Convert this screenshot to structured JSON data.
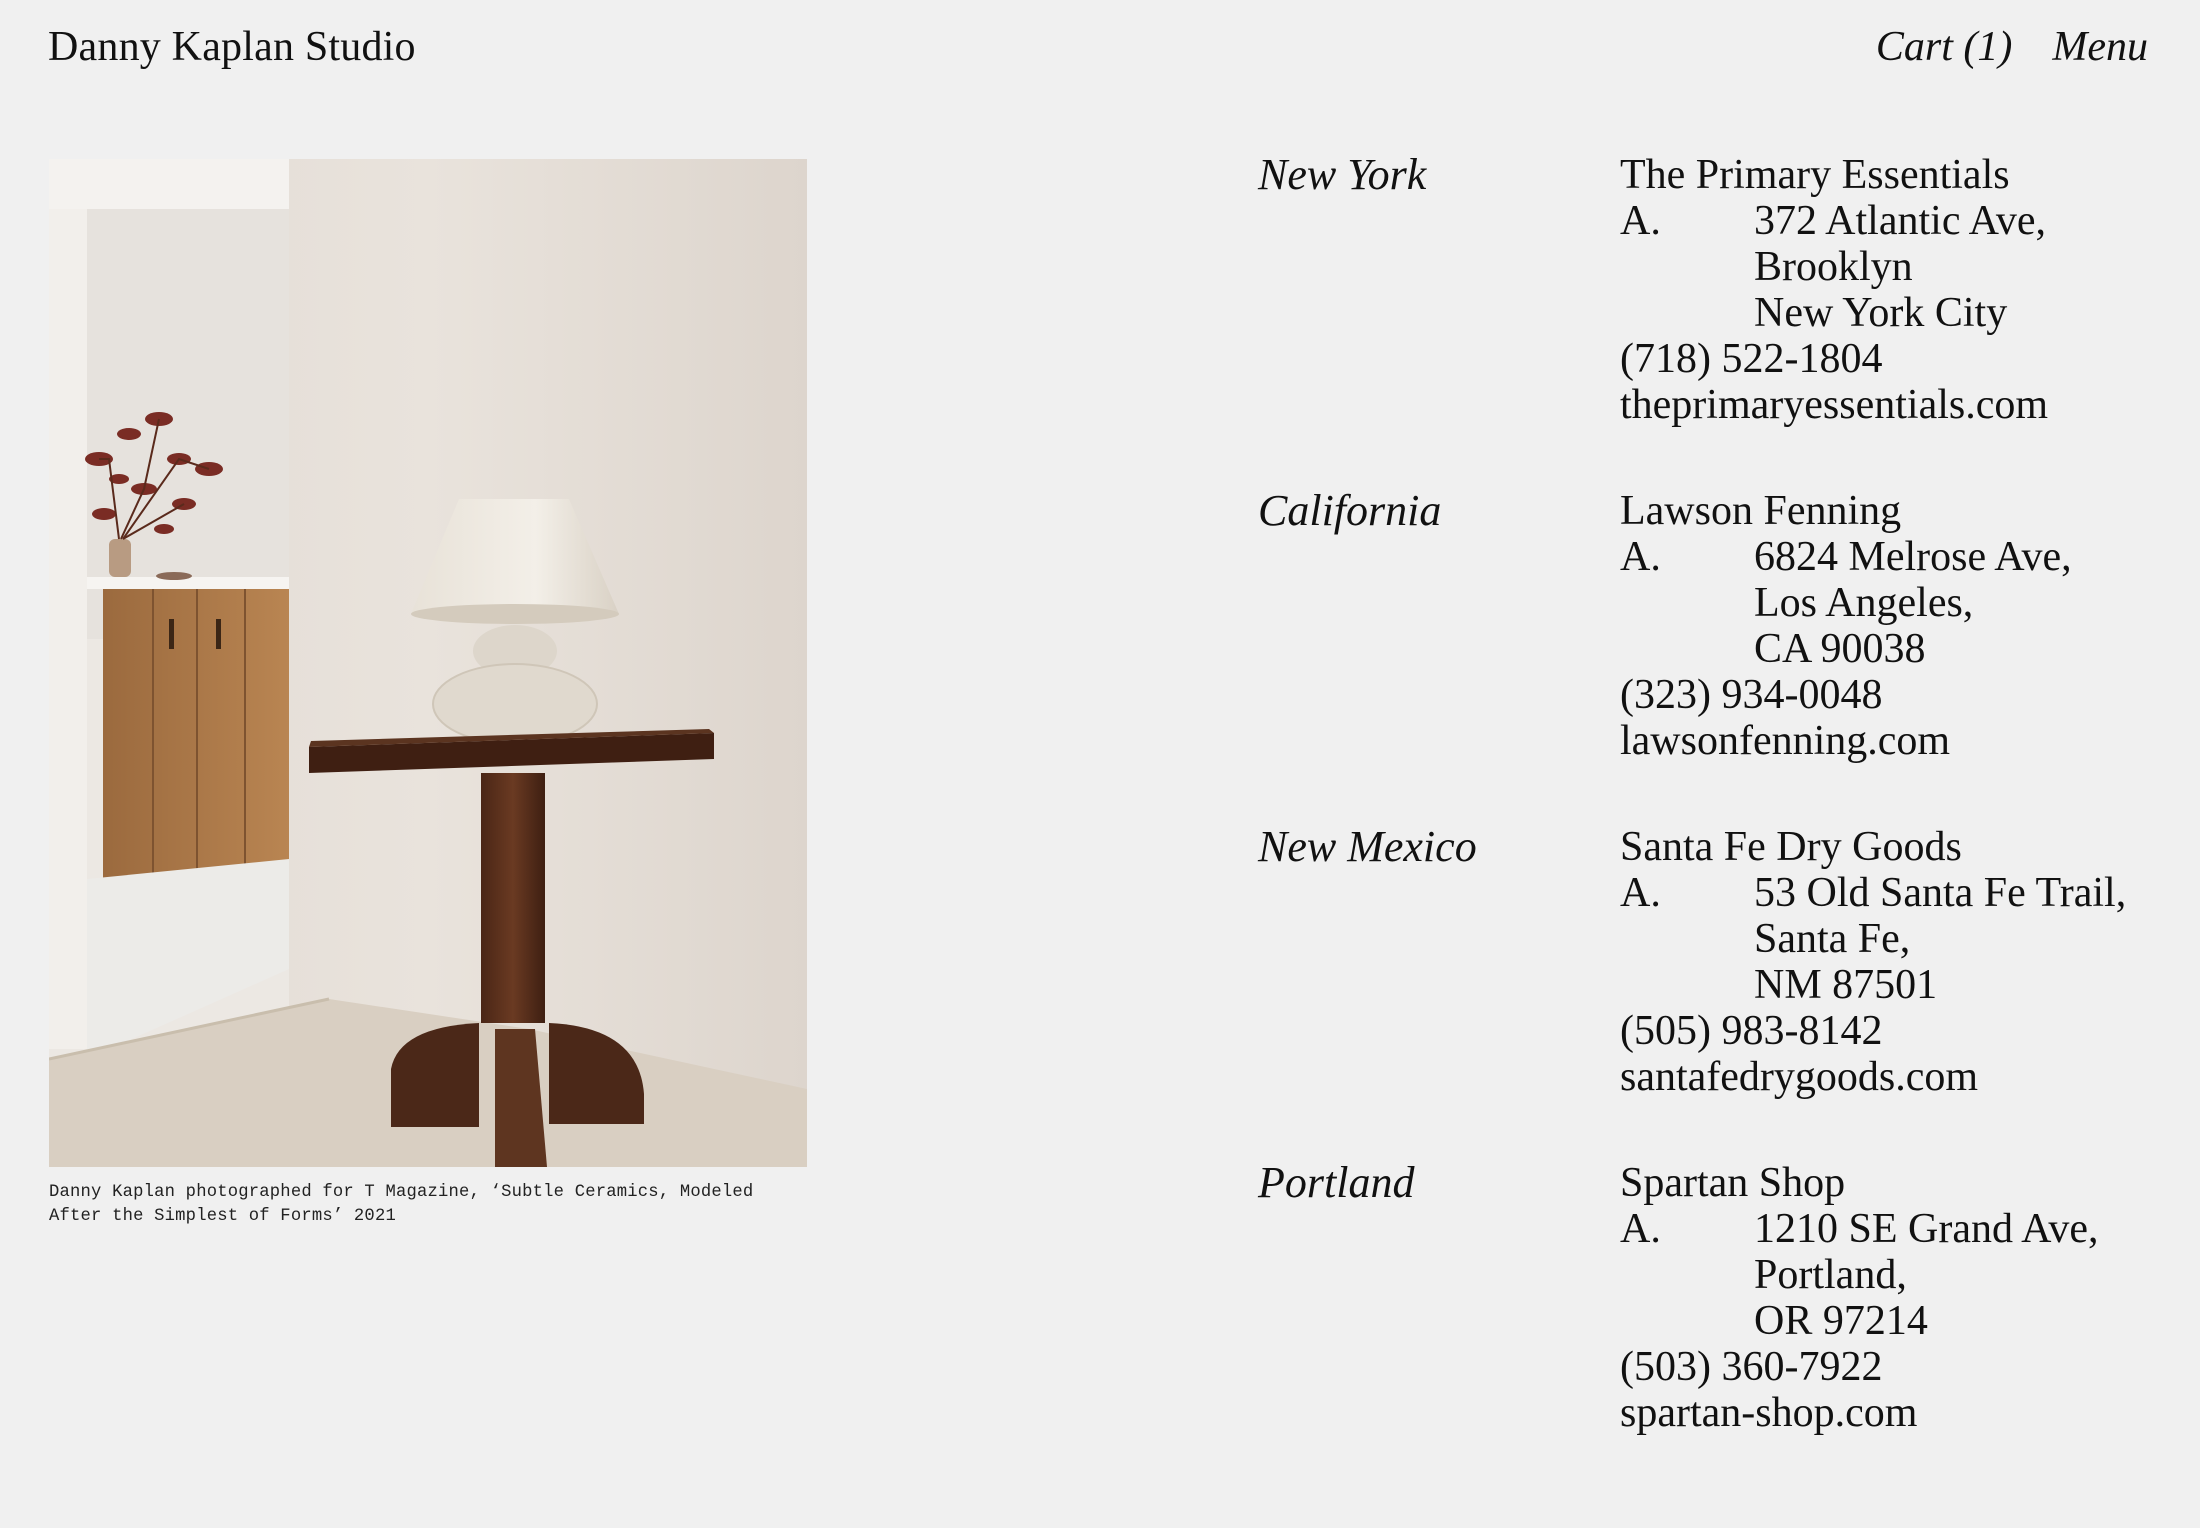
{
  "header": {
    "brand": "Danny Kaplan Studio",
    "cart_label": "Cart (1)",
    "menu_label": "Menu"
  },
  "figure": {
    "caption_line1": "Danny Kaplan photographed for T Magazine, ‘Subtle Ceramics, Modeled",
    "caption_line2": "After the Simplest of Forms’ 2021"
  },
  "stockists": [
    {
      "region": "New York",
      "name": "The Primary Essentials",
      "address_label": "A.",
      "address": [
        "372 Atlantic Ave,",
        "Brooklyn",
        "New York City"
      ],
      "phone": "(718) 522-1804",
      "website": "theprimaryessentials.com"
    },
    {
      "region": "California",
      "name": "Lawson Fenning",
      "address_label": "A.",
      "address": [
        "6824 Melrose Ave,",
        "Los Angeles,",
        "CA 90038"
      ],
      "phone": "(323) 934-0048",
      "website": "lawsonfenning.com"
    },
    {
      "region": "New Mexico",
      "name": "Santa Fe Dry Goods",
      "address_label": "A.",
      "address": [
        "53 Old Santa Fe Trail,",
        "Santa Fe,",
        "NM 87501"
      ],
      "phone": "(505) 983-8142",
      "website": "santafedrygoods.com"
    },
    {
      "region": "Portland",
      "name": "Spartan Shop",
      "address_label": "A.",
      "address": [
        "1210 SE Grand Ave,",
        "Portland,",
        "OR 97214"
      ],
      "phone": "(503) 360-7922",
      "website": "spartan-shop.com"
    }
  ]
}
